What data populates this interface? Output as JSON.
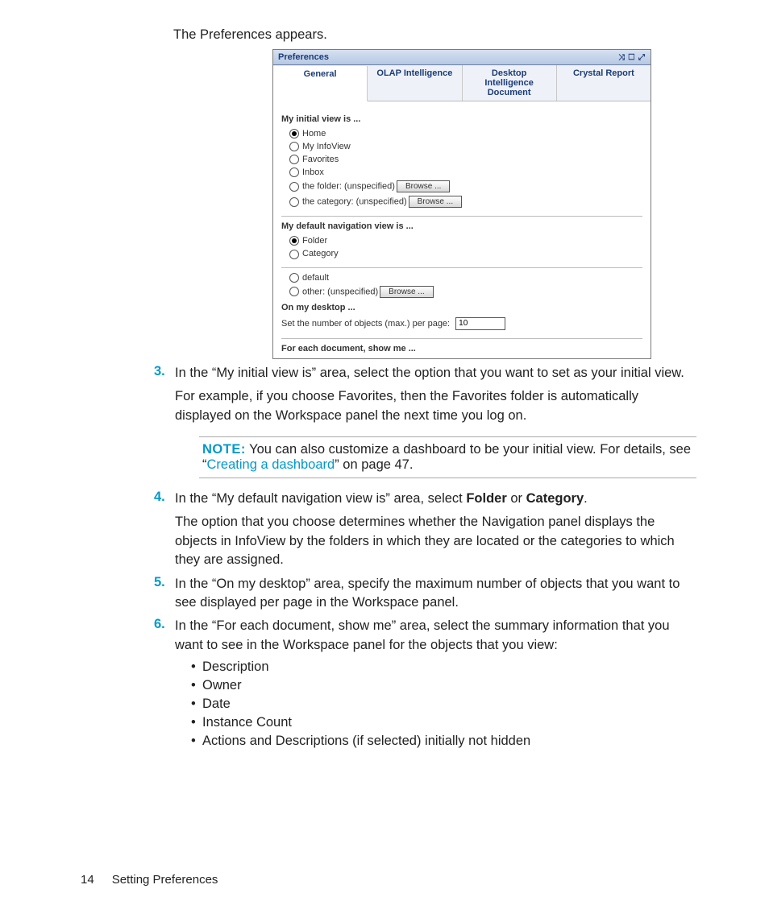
{
  "intro": "The Preferences appears.",
  "ss": {
    "title": "Preferences",
    "tabs": {
      "general": "General",
      "olap": "OLAP Intelligence",
      "desktop": "Desktop Intelligence Document",
      "crystal": "Crystal Report"
    },
    "sections": {
      "initView": {
        "heading": "My initial view is ...",
        "home": "Home",
        "myinfo": "My InfoView",
        "favorites": "Favorites",
        "inbox": "Inbox",
        "folder": "the folder: (unspecified)",
        "category": "the category: (unspecified)",
        "browse": "Browse ..."
      },
      "navView": {
        "heading": "My default navigation view is ...",
        "folder": "Folder",
        "category": "Category"
      },
      "other": {
        "default": "default",
        "otheropt": "other: (unspecified)",
        "browse": "Browse ..."
      },
      "desktop": {
        "heading": "On my desktop ...",
        "maxline": "Set the number of objects (max.) per page:",
        "value": "10"
      },
      "each": {
        "heading": "For each document, show me ..."
      }
    },
    "icons": "⤨ ☐ ⤢"
  },
  "steps": {
    "s3": {
      "num": "3.",
      "p1": "In the “My initial view is” area, select the option that you want to set as your initial view.",
      "p2": "For example, if you choose Favorites, then the Favorites folder is automatically displayed on the Workspace panel the next time you log on."
    },
    "note": {
      "label": "NOTE:",
      "before": "   You can also customize a dashboard to be your initial view. For details, see “",
      "link": "Creating a dashboard",
      "after": "” on page 47."
    },
    "s4": {
      "num": "4.",
      "p1a": "In the “My default navigation view is” area, select ",
      "b1": "Folder",
      "p1b": " or ",
      "b2": "Category",
      "p1c": ".",
      "p2": "The option that you choose determines whether the Navigation panel displays the objects in InfoView by the folders in which they are located or the categories to which they are assigned."
    },
    "s5": {
      "num": "5.",
      "p1": "In the “On my desktop” area, specify the maximum number of objects that you want to see displayed per page in the Workspace panel."
    },
    "s6": {
      "num": "6.",
      "p1": "In the “For each document, show me” area, select the summary information that you want to see in the Workspace panel for the objects that you view:",
      "bul1": "Description",
      "bul2": "Owner",
      "bul3": "Date",
      "bul4": "Instance Count",
      "bul5": "Actions and Descriptions (if selected) initially not hidden"
    }
  },
  "footer": {
    "page": "14",
    "section": "Setting Preferences"
  }
}
